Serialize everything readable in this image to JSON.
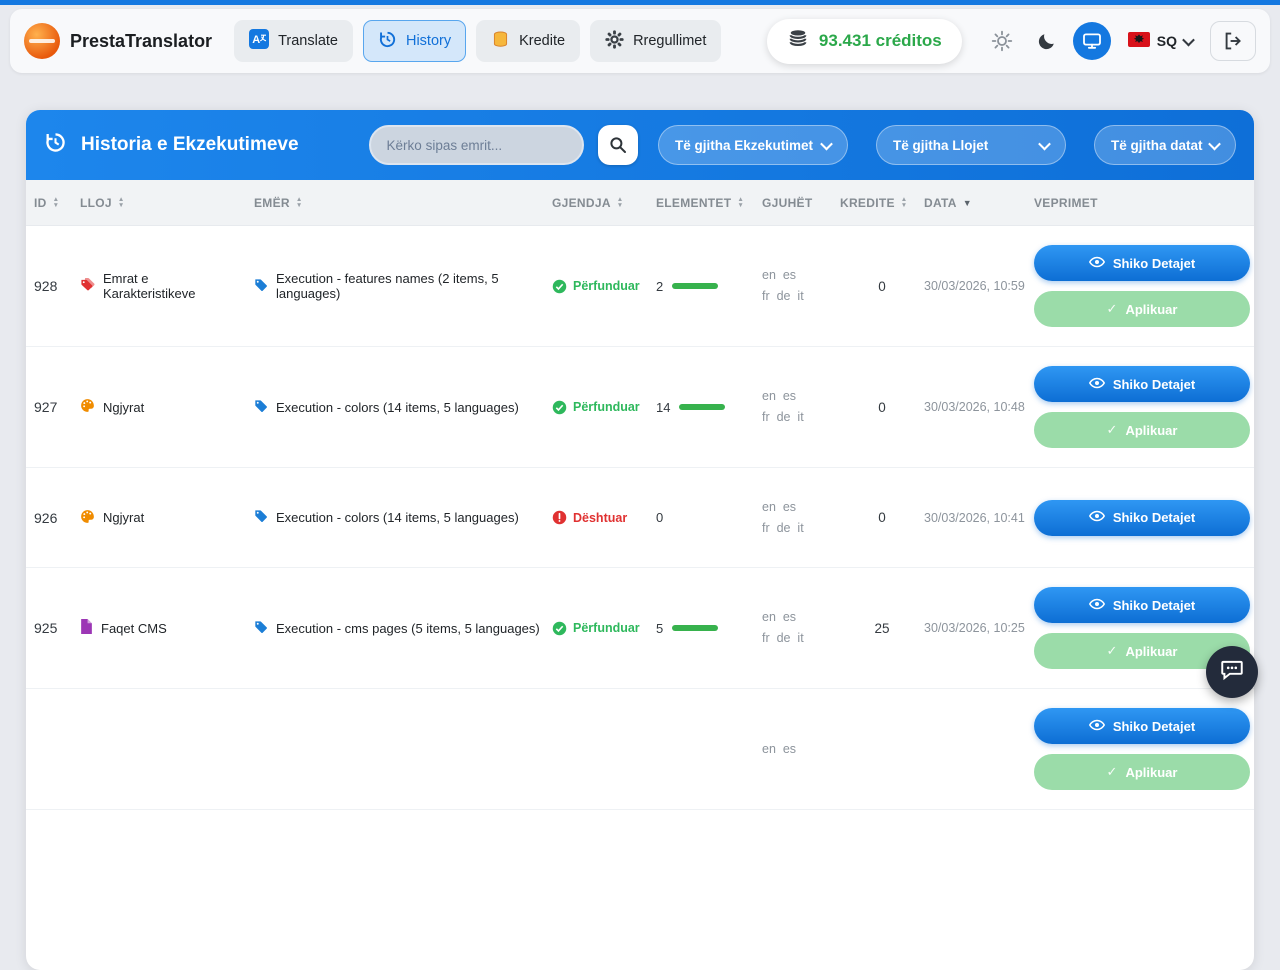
{
  "colors": {
    "accent": "#1478e0",
    "success": "#2eb85c",
    "danger": "#e03131",
    "credits_green": "#2ba84a",
    "tag": "#1c7ed6",
    "applied": "#9bdca9"
  },
  "navbar": {
    "brand": "PrestaTranslator",
    "items": [
      {
        "id": "translate",
        "label": "Translate",
        "icon": "translate-icon",
        "active": false
      },
      {
        "id": "history",
        "label": "History",
        "icon": "history-icon",
        "active": true
      },
      {
        "id": "kredite",
        "label": "Kredite",
        "icon": "coins-icon",
        "active": false
      },
      {
        "id": "rregullimet",
        "label": "Rregullimet",
        "icon": "gear-icon",
        "active": false
      }
    ],
    "credits_label": "93.431 créditos",
    "language": "SQ"
  },
  "panel": {
    "title": "Historia e Ekzekutimeve",
    "search": {
      "placeholder": "Kërko sipas emrit..."
    },
    "filters": [
      {
        "id": "executions",
        "label": "Të gjitha Ekzekutimet"
      },
      {
        "id": "types",
        "label": "Të gjitha Llojet"
      },
      {
        "id": "dates",
        "label": "Të gjitha datat"
      }
    ]
  },
  "table": {
    "headers": [
      {
        "label": "ID",
        "sortable": true
      },
      {
        "label": "LLOJ",
        "sortable": true
      },
      {
        "label": "EMËR",
        "sortable": true
      },
      {
        "label": "GJENDJA",
        "sortable": true
      },
      {
        "label": "ELEMENTET",
        "sortable": true
      },
      {
        "label": "GJUHËT",
        "sortable": false
      },
      {
        "label": "KREDITE",
        "sortable": true
      },
      {
        "label": "DATA",
        "sortable": true,
        "sorted": "desc"
      },
      {
        "label": "VEPRIMET",
        "sortable": false
      }
    ],
    "actions": {
      "view_label": "Shiko Detajet",
      "applied_label": "Aplikuar"
    },
    "rows": [
      {
        "id": "928",
        "type": {
          "label": "Emrat e Karakteristikeve",
          "icon": "tags-icon",
          "color": "#e03131"
        },
        "name": "Execution - features names (2 items, 5 languages)",
        "status": {
          "label": "Përfunduar",
          "state": "success"
        },
        "elements": "2",
        "languages": [
          "en",
          "es",
          "fr",
          "de",
          "it"
        ],
        "credits": "0",
        "date": "30/03/2026, 10:59",
        "applied": true
      },
      {
        "id": "927",
        "type": {
          "label": "Ngjyrat",
          "icon": "palette-icon",
          "color": "#f08c00"
        },
        "name": "Execution - colors (14 items, 5 languages)",
        "status": {
          "label": "Përfunduar",
          "state": "success"
        },
        "elements": "14",
        "languages": [
          "en",
          "es",
          "fr",
          "de",
          "it"
        ],
        "credits": "0",
        "date": "30/03/2026, 10:48",
        "applied": true
      },
      {
        "id": "926",
        "type": {
          "label": "Ngjyrat",
          "icon": "palette-icon",
          "color": "#f08c00"
        },
        "name": "Execution - colors (14 items, 5 languages)",
        "status": {
          "label": "Dështuar",
          "state": "danger"
        },
        "elements": "0",
        "languages": [
          "en",
          "es",
          "fr",
          "de",
          "it"
        ],
        "credits": "0",
        "date": "30/03/2026, 10:41",
        "applied": false
      },
      {
        "id": "925",
        "type": {
          "label": "Faqet CMS",
          "icon": "file-icon",
          "color": "#9c36b5"
        },
        "name": "Execution - cms pages (5 items, 5 languages)",
        "status": {
          "label": "Përfunduar",
          "state": "success"
        },
        "elements": "5",
        "languages": [
          "en",
          "es",
          "fr",
          "de",
          "it"
        ],
        "credits": "25",
        "date": "30/03/2026, 10:25",
        "applied": true
      },
      {
        "id": "",
        "type": {
          "label": "",
          "icon": "",
          "color": ""
        },
        "name": "",
        "status": {
          "label": "",
          "state": ""
        },
        "elements": "",
        "languages": [
          "en",
          "es"
        ],
        "credits": "",
        "date": "",
        "applied": true
      }
    ]
  }
}
